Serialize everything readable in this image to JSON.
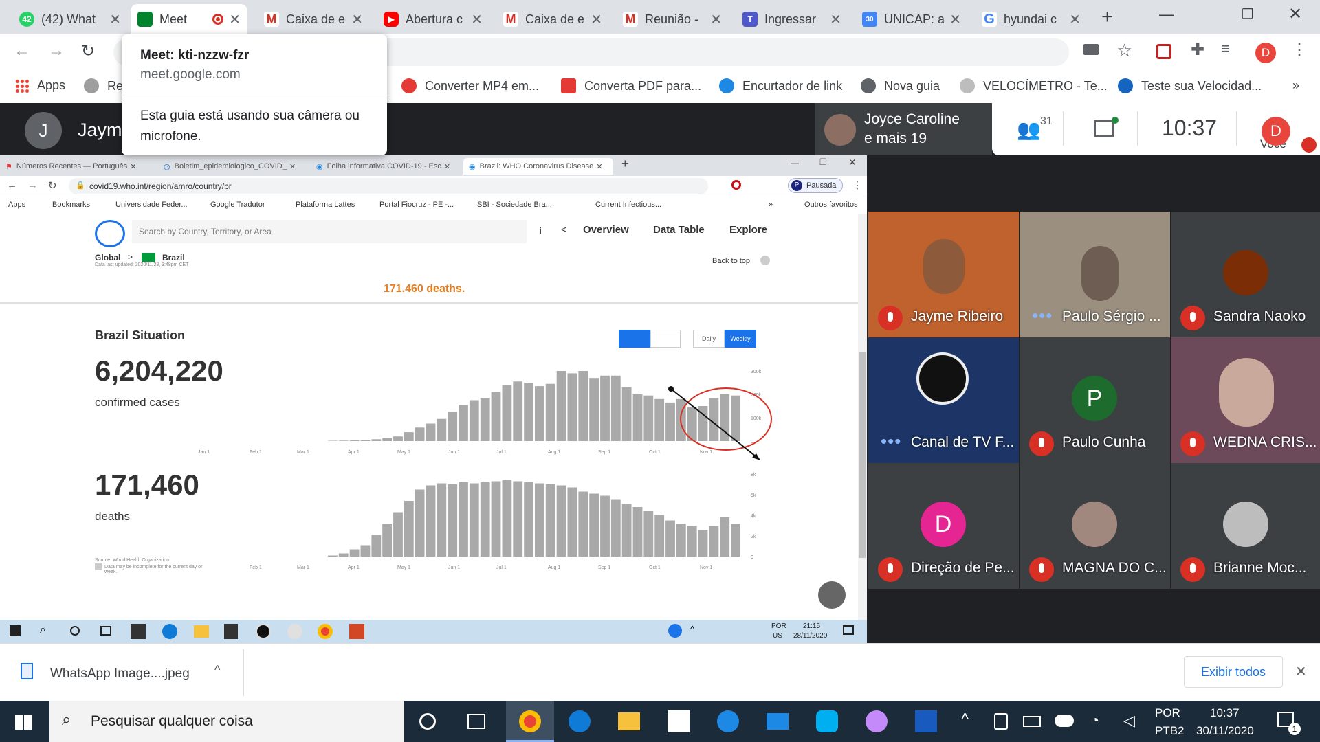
{
  "browser": {
    "tabs": [
      {
        "title": "(42) What",
        "badge": "42"
      },
      {
        "title": "Meet",
        "active": true
      },
      {
        "title": "Caixa de e"
      },
      {
        "title": "Abertura c"
      },
      {
        "title": "Caixa de e"
      },
      {
        "title": "Reunião -"
      },
      {
        "title": "Ingressar"
      },
      {
        "title": "UNICAP: a"
      },
      {
        "title": "hyundai c"
      }
    ],
    "new_tab": "+",
    "bookmarks": [
      {
        "label": "Apps"
      },
      {
        "label": "Re"
      },
      {
        "label": "Converter MP4 em..."
      },
      {
        "label": "Converta PDF para..."
      },
      {
        "label": "Encurtador de link"
      },
      {
        "label": "Nova guia"
      },
      {
        "label": "VELOCÍMETRO - Te..."
      },
      {
        "label": "Teste sua Velocidad..."
      }
    ],
    "profile_initial": "D"
  },
  "popup": {
    "title": "Meet: kti-nzzw-fzr",
    "domain": "meet.google.com",
    "message": "Esta guia está usando sua câmera ou microfone."
  },
  "meet": {
    "presenter_initial": "J",
    "presenter_name": "Jaym",
    "featured_name": "Joyce Caroline",
    "featured_more": "e mais 19",
    "people_count": "31",
    "clock": "10:37",
    "you_label": "Você",
    "you_initial": "D",
    "participants": [
      {
        "name": "Jayme Ribeiro",
        "status": "muted"
      },
      {
        "name": "Paulo Sérgio ...",
        "status": "speaking"
      },
      {
        "name": "Sandra Naoko",
        "status": "muted"
      },
      {
        "name": "Canal de TV F...",
        "status": "speaking"
      },
      {
        "name": "Paulo Cunha",
        "status": "muted",
        "initial": "P"
      },
      {
        "name": "WEDNA CRIS...",
        "status": "muted"
      },
      {
        "name": "Direção de Pe...",
        "status": "muted",
        "initial": "D"
      },
      {
        "name": "MAGNA DO C...",
        "status": "muted"
      },
      {
        "name": "Brianne Moc...",
        "status": "muted"
      }
    ]
  },
  "shared": {
    "tabs": [
      "Números Recentes — Português",
      "Boletim_epidemiologico_COVID_",
      "Folha informativa COVID-19 - Esc",
      "Brazil: WHO Coronavirus Disease"
    ],
    "url": "covid19.who.int/region/amro/country/br",
    "pause_label": "Pausada",
    "pause_initial": "P",
    "bookmarks": [
      "Apps",
      "Bookmarks",
      "Universidade Feder...",
      "Google Tradutor",
      "Plataforma Lattes",
      "Portal Fiocruz - PE -...",
      "SBI - Sociedade Bra...",
      "Current Infectious...",
      "»",
      "Outros favoritos"
    ],
    "who": {
      "search_placeholder": "Search by Country, Territory, or Area",
      "nav": [
        "Overview",
        "Data Table",
        "Explore"
      ],
      "info_icon": "i",
      "breadcrumb_global": "Global",
      "breadcrumb_arrow": ">",
      "breadcrumb_country": "Brazil",
      "last_updated": "Data last updated: 2020/11/28, 3:48pm CET",
      "back_to_top": "Back to top",
      "deaths_snippet": "171.460 deaths",
      "section_title": "Brazil Situation",
      "confirmed_value": "6,204,220",
      "confirmed_label": "confirmed cases",
      "deaths_value": "171,460",
      "deaths_label": "deaths",
      "toggle_daily": "Daily",
      "toggle_weekly": "Weekly",
      "source": "Source: World Health Organization",
      "incomplete_note": "Data may be incomplete for the current day or week."
    },
    "taskbar": {
      "lang1": "POR",
      "lang2": "US",
      "time": "21:15",
      "date": "28/11/2020"
    }
  },
  "chart_data": [
    {
      "type": "bar",
      "title": "",
      "xlabel": "",
      "ylabel": "",
      "x_tick_labels": [
        "Jan 1",
        "Feb 1",
        "Mar 1",
        "Apr 1",
        "May 1",
        "Jun 1",
        "Jul 1",
        "Aug 1",
        "Sep 1",
        "Oct 1",
        "Nov 1"
      ],
      "y_tick_labels": [
        "300k",
        "200k",
        "100k",
        "0"
      ],
      "ylim": [
        0,
        300000
      ],
      "values": [
        1000,
        2000,
        4000,
        6000,
        8000,
        12000,
        20000,
        38000,
        58000,
        75000,
        95000,
        125000,
        155000,
        175000,
        185000,
        210000,
        240000,
        255000,
        250000,
        235000,
        245000,
        300000,
        290000,
        300000,
        270000,
        280000,
        280000,
        230000,
        200000,
        195000,
        180000,
        165000,
        180000,
        145000,
        150000,
        185000,
        200000,
        195000
      ],
      "annotation": "circled decline with arrow"
    },
    {
      "type": "bar",
      "title": "",
      "xlabel": "",
      "ylabel": "",
      "x_tick_labels": [
        "Feb 1",
        "Mar 1",
        "Apr 1",
        "May 1",
        "Jun 1",
        "Jul 1",
        "Aug 1",
        "Sep 1",
        "Oct 1",
        "Nov 1"
      ],
      "y_tick_labels": [
        "8k",
        "6k",
        "4k",
        "2k",
        "0"
      ],
      "ylim": [
        0,
        8000
      ],
      "values": [
        100,
        300,
        700,
        1100,
        2100,
        3200,
        4300,
        5400,
        6500,
        6900,
        7100,
        7000,
        7200,
        7100,
        7200,
        7300,
        7400,
        7300,
        7200,
        7100,
        7000,
        6900,
        6700,
        6300,
        6100,
        5900,
        5500,
        5100,
        4800,
        4400,
        4000,
        3500,
        3200,
        3000,
        2600,
        3000,
        3800,
        3200
      ]
    }
  ],
  "downloads": {
    "file": "WhatsApp Image....jpeg",
    "show_all": "Exibir todos"
  },
  "taskbar": {
    "search_placeholder": "Pesquisar qualquer coisa",
    "lang1": "POR",
    "lang2": "PTB2",
    "time": "10:37",
    "date": "30/11/2020",
    "notif_count": "1"
  }
}
